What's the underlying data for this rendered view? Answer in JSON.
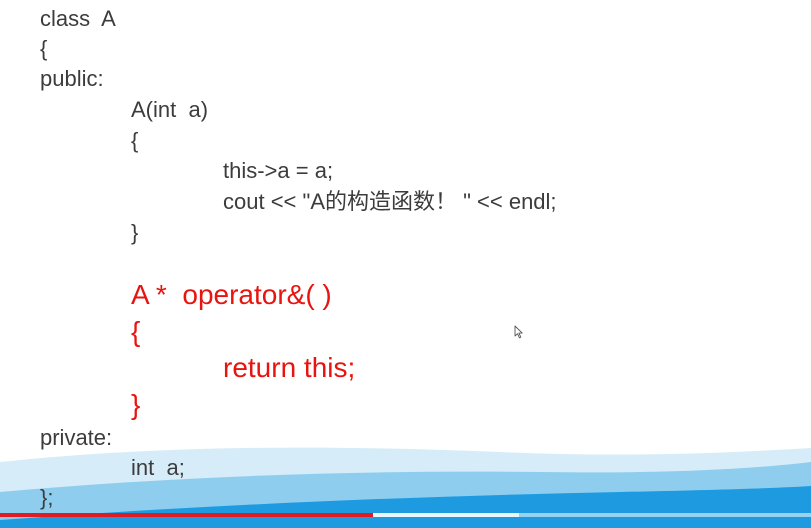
{
  "code": {
    "lines": [
      "class  A",
      "{",
      "public:",
      "A(int  a)",
      "{",
      "this->a = a;",
      "cout << \"A的构造函数！ \" << endl;",
      "}",
      "A *  operator&( )",
      "{",
      "return this;",
      "}",
      "private:",
      "int  a;",
      "};"
    ]
  },
  "colors": {
    "text": "#3c3c3c",
    "highlight": "#e8140f",
    "wave_light": "#d6ecf8",
    "wave_mid": "#8fcdef",
    "wave_dark": "#1e9be0",
    "progress_played": "#e01b22"
  },
  "player": {
    "progress_fraction": 0.46,
    "buffered_fraction": 0.64
  },
  "icons": {
    "pointer": "mouse-pointer-icon"
  }
}
